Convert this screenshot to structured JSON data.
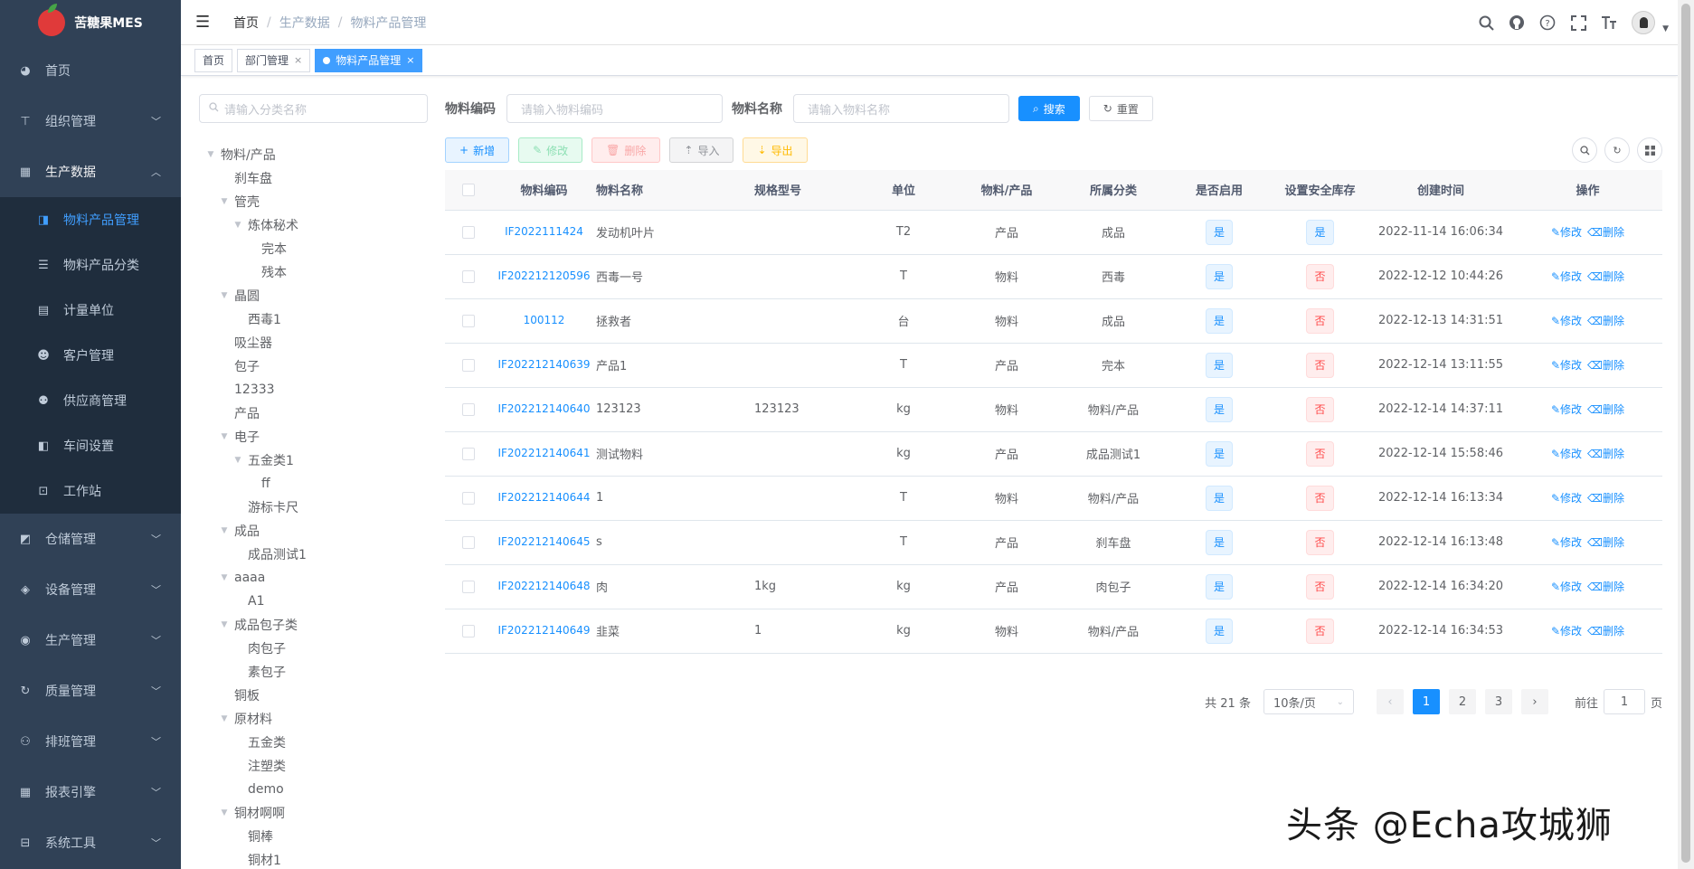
{
  "app": {
    "title": "苦糖果MES"
  },
  "sidebar": {
    "items": [
      {
        "label": "首页",
        "icon": "dashboard-icon",
        "glyph": "◕",
        "has_children": false
      },
      {
        "label": "组织管理",
        "icon": "org-tree-icon",
        "glyph": "⊤",
        "has_children": true
      },
      {
        "label": "生产数据",
        "icon": "grid-data-icon",
        "glyph": "▦",
        "has_children": true,
        "expanded": true,
        "children": [
          {
            "label": "物料产品管理",
            "icon": "material-book-icon",
            "glyph": "◨",
            "active": true
          },
          {
            "label": "物料产品分类",
            "icon": "list-tree-icon",
            "glyph": "☰"
          },
          {
            "label": "计量单位",
            "icon": "calendar-icon",
            "glyph": "▤"
          },
          {
            "label": "客户管理",
            "icon": "customer-icon",
            "glyph": "☻"
          },
          {
            "label": "供应商管理",
            "icon": "supplier-icon",
            "glyph": "⚉"
          },
          {
            "label": "车间设置",
            "icon": "workshop-icon",
            "glyph": "◧"
          },
          {
            "label": "工作站",
            "icon": "workstation-icon",
            "glyph": "⊡"
          }
        ]
      },
      {
        "label": "仓储管理",
        "icon": "warehouse-icon",
        "glyph": "◩",
        "has_children": true
      },
      {
        "label": "设备管理",
        "icon": "equipment-icon",
        "glyph": "◈",
        "has_children": true
      },
      {
        "label": "生产管理",
        "icon": "production-icon",
        "glyph": "◉",
        "has_children": true
      },
      {
        "label": "质量管理",
        "icon": "quality-icon",
        "glyph": "↻",
        "has_children": true
      },
      {
        "label": "排班管理",
        "icon": "schedule-icon",
        "glyph": "⚇",
        "has_children": true
      },
      {
        "label": "报表引擎",
        "icon": "report-icon",
        "glyph": "▦",
        "has_children": true
      },
      {
        "label": "系统工具",
        "icon": "tools-icon",
        "glyph": "⊟",
        "has_children": true
      }
    ]
  },
  "navbar": {
    "breadcrumb": [
      "首页",
      "生产数据",
      "物料产品管理"
    ],
    "icons": [
      "search-icon",
      "github-icon",
      "help-icon",
      "fullscreen-icon",
      "font-size-icon"
    ]
  },
  "tags": [
    {
      "label": "首页",
      "active": false,
      "closable": false
    },
    {
      "label": "部门管理",
      "active": false,
      "closable": true
    },
    {
      "label": "物料产品管理",
      "active": true,
      "closable": true
    }
  ],
  "tree": {
    "search_placeholder": "请输入分类名称",
    "nodes": [
      {
        "label": "物料/产品",
        "level": 0,
        "expanded": true
      },
      {
        "label": "刹车盘",
        "level": 1
      },
      {
        "label": "管壳",
        "level": 1,
        "expanded": true
      },
      {
        "label": "炼体秘术",
        "level": 2,
        "expanded": true
      },
      {
        "label": "完本",
        "level": 3
      },
      {
        "label": "残本",
        "level": 3
      },
      {
        "label": "晶圆",
        "level": 1,
        "expanded": true
      },
      {
        "label": "西毒1",
        "level": 2
      },
      {
        "label": "吸尘器",
        "level": 1
      },
      {
        "label": "包子",
        "level": 1
      },
      {
        "label": "12333",
        "level": 1
      },
      {
        "label": "产品",
        "level": 1
      },
      {
        "label": "电子",
        "level": 1,
        "expanded": true
      },
      {
        "label": "五金类1",
        "level": 2,
        "expanded": true
      },
      {
        "label": "ff",
        "level": 3
      },
      {
        "label": "游标卡尺",
        "level": 2
      },
      {
        "label": "成品",
        "level": 1,
        "expanded": true
      },
      {
        "label": "成品测试1",
        "level": 2
      },
      {
        "label": "aaaa",
        "level": 1,
        "expanded": true
      },
      {
        "label": "A1",
        "level": 2
      },
      {
        "label": "成品包子类",
        "level": 1,
        "expanded": true
      },
      {
        "label": "肉包子",
        "level": 2
      },
      {
        "label": "素包子",
        "level": 2
      },
      {
        "label": "铜板",
        "level": 1
      },
      {
        "label": "原材料",
        "level": 1,
        "expanded": true
      },
      {
        "label": "五金类",
        "level": 2
      },
      {
        "label": "注塑类",
        "level": 2
      },
      {
        "label": "demo",
        "level": 2
      },
      {
        "label": "铜材啊啊",
        "level": 1,
        "expanded": true
      },
      {
        "label": "铜棒",
        "level": 2
      },
      {
        "label": "铜材1",
        "level": 2
      }
    ]
  },
  "filters": {
    "code_label": "物料编码",
    "code_placeholder": "请输入物料编码",
    "name_label": "物料名称",
    "name_placeholder": "请输入物料名称",
    "search_label": "搜索",
    "reset_label": "重置"
  },
  "toolbar": {
    "add_label": "新增",
    "edit_label": "修改",
    "delete_label": "删除",
    "import_label": "导入",
    "export_label": "导出"
  },
  "table": {
    "headers": [
      "物料编码",
      "物料名称",
      "规格型号",
      "单位",
      "物料/产品",
      "所属分类",
      "是否启用",
      "设置安全库存",
      "创建时间",
      "操作"
    ],
    "edit_label": "修改",
    "delete_label": "删除",
    "rows": [
      {
        "code": "IF2022111424",
        "name": "发动机叶片",
        "spec": "",
        "unit": "T2",
        "type": "产品",
        "category": "成品",
        "enabled": "是",
        "safety": "是",
        "created": "2022-11-14 16:06:34"
      },
      {
        "code": "IF202212120596",
        "name": "西毒一号",
        "spec": "",
        "unit": "T",
        "type": "物料",
        "category": "西毒",
        "enabled": "是",
        "safety": "否",
        "created": "2022-12-12 10:44:26"
      },
      {
        "code": "100112",
        "name": "拯救者",
        "spec": "",
        "unit": "台",
        "type": "物料",
        "category": "成品",
        "enabled": "是",
        "safety": "否",
        "created": "2022-12-13 14:31:51"
      },
      {
        "code": "IF202212140639",
        "name": "产品1",
        "spec": "",
        "unit": "T",
        "type": "产品",
        "category": "完本",
        "enabled": "是",
        "safety": "否",
        "created": "2022-12-14 13:11:55"
      },
      {
        "code": "IF202212140640",
        "name": "123123",
        "spec": "123123",
        "unit": "kg",
        "type": "物料",
        "category": "物料/产品",
        "enabled": "是",
        "safety": "否",
        "created": "2022-12-14 14:37:11"
      },
      {
        "code": "IF202212140641",
        "name": "测试物料",
        "spec": "",
        "unit": "kg",
        "type": "产品",
        "category": "成品测试1",
        "enabled": "是",
        "safety": "否",
        "created": "2022-12-14 15:58:46"
      },
      {
        "code": "IF202212140644",
        "name": "1",
        "spec": "",
        "unit": "T",
        "type": "物料",
        "category": "物料/产品",
        "enabled": "是",
        "safety": "否",
        "created": "2022-12-14 16:13:34"
      },
      {
        "code": "IF202212140645",
        "name": "s",
        "spec": "",
        "unit": "T",
        "type": "产品",
        "category": "刹车盘",
        "enabled": "是",
        "safety": "否",
        "created": "2022-12-14 16:13:48"
      },
      {
        "code": "IF202212140648",
        "name": "肉",
        "spec": "1kg",
        "unit": "kg",
        "type": "产品",
        "category": "肉包子",
        "enabled": "是",
        "safety": "否",
        "created": "2022-12-14 16:34:20"
      },
      {
        "code": "IF202212140649",
        "name": "韭菜",
        "spec": "1",
        "unit": "kg",
        "type": "物料",
        "category": "物料/产品",
        "enabled": "是",
        "safety": "否",
        "created": "2022-12-14 16:34:53"
      }
    ]
  },
  "pagination": {
    "total_text": "共 21 条",
    "page_size": "10条/页",
    "pages": [
      "1",
      "2",
      "3"
    ],
    "current": "1",
    "goto_prefix": "前往",
    "goto_value": "1",
    "goto_suffix": "页"
  },
  "watermark": "头条 @Echa攻城狮",
  "colors": {
    "sidebar_bg": "#304156",
    "submenu_bg": "#1f2d3d",
    "primary": "#1890ff",
    "danger": "#ff4949"
  }
}
